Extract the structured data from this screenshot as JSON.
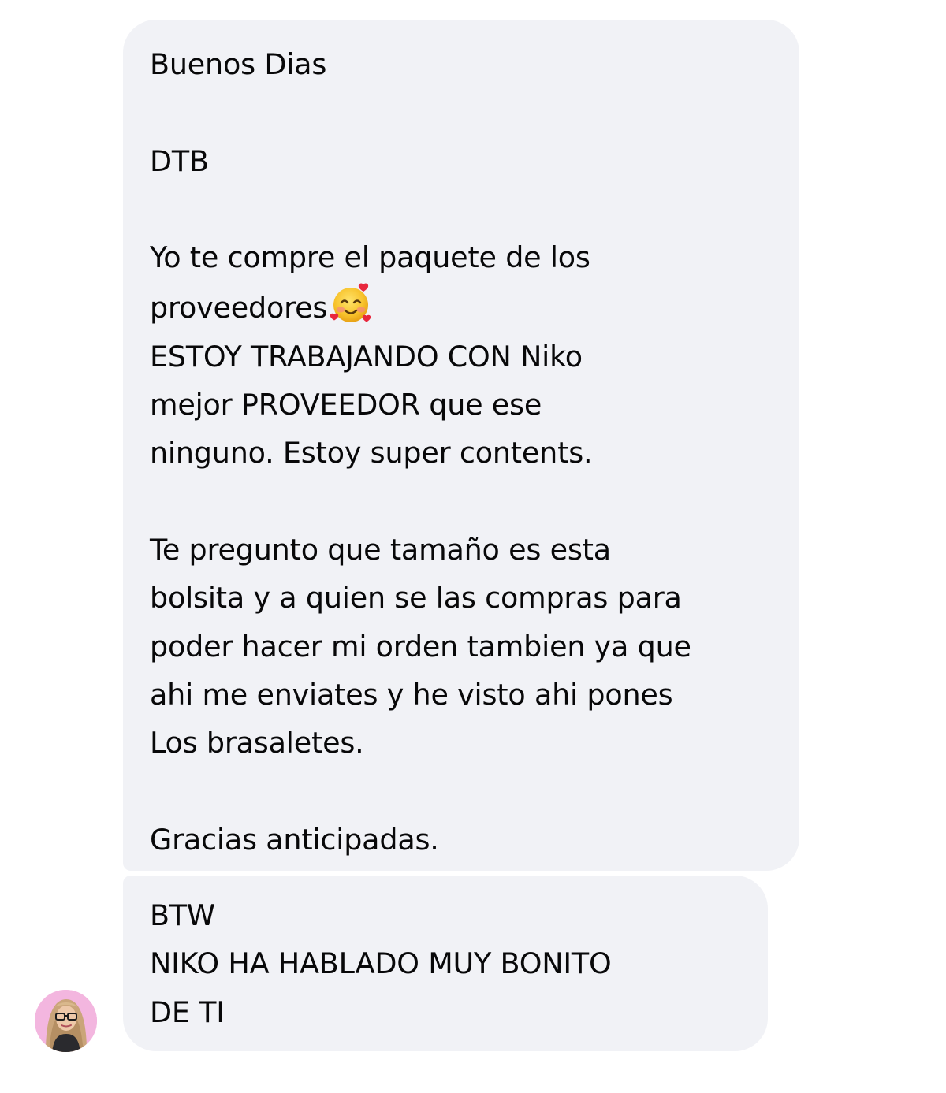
{
  "conversation": {
    "messages": [
      {
        "lines": [
          "Buenos Dias",
          "",
          "DTB",
          "",
          "Yo te compre el paquete de los",
          "proveedores",
          "ESTOY TRABAJANDO CON Niko",
          "mejor PROVEEDOR que ese",
          "ninguno. Estoy super contents.",
          "",
          "Te pregunto que tamaño es esta",
          "bolsita y a quien se las compras para",
          "poder hacer mi orden tambien ya que",
          "ahi me enviates y he visto ahi pones",
          "Los brasaletes.",
          "",
          "Gracias anticipadas."
        ],
        "emoji": "smiling-face-with-hearts-icon"
      },
      {
        "lines": [
          "BTW",
          "NIKO HA HABLADO MUY BONITO",
          "DE TI"
        ]
      }
    ]
  },
  "colors": {
    "bubble_background": "#f1f2f6",
    "text": "#080809",
    "avatar_background": "#f3b6df"
  }
}
